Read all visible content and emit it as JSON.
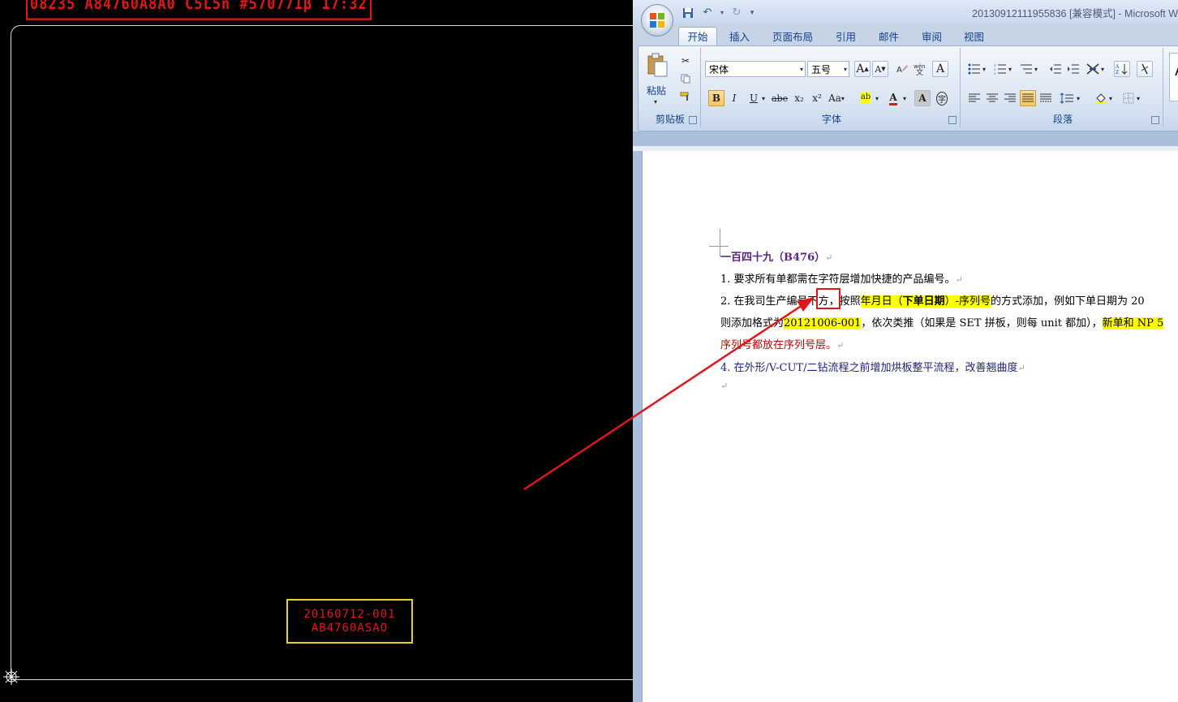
{
  "cad": {
    "top_banner": "08235  A84760A8A0  C5L5n  #570771β  17:32",
    "label_box": {
      "line1": "20160712-001",
      "line2": "AB4760ASAO"
    },
    "colors": {
      "label_text": "#e0161b",
      "label_box_border": "#e8d21e",
      "outline": "#d8d8d8"
    }
  },
  "word": {
    "window_title": "20130912111955836 [兼容模式] - Microsoft W",
    "tabs": [
      "开始",
      "插入",
      "页面布局",
      "引用",
      "邮件",
      "审阅",
      "视图"
    ],
    "active_tab": "开始",
    "ribbon": {
      "clipboard": {
        "paste_label": "粘贴",
        "group_label": "剪贴板"
      },
      "font": {
        "font_name": "宋体",
        "font_size": "五号",
        "grow": "A",
        "shrink": "A",
        "bold": "B",
        "italic": "I",
        "underline": "U",
        "strike": "abe",
        "subscript": "x₂",
        "superscript": "x²",
        "change_case": "Aa",
        "highlight": "ab",
        "font_color": "A",
        "char_shade": "A",
        "enclose": "字",
        "group_label": "字体"
      },
      "paragraph": {
        "group_label": "段落"
      },
      "styles": {
        "preview": "A"
      }
    },
    "document": {
      "heading": "一百四十九（B476）",
      "line1": "1. 要求所有单都需在字符层增加快捷的产品编号。",
      "line2": {
        "pre": "2. 在我司生产编号",
        "boxed": "下方",
        "mid": "，按照",
        "hl_a": "年月日（",
        "hl_b": "下单日期",
        "hl_c": "）-序列号",
        "post": "的方式添加，例如下单日期为 20"
      },
      "line3": {
        "pre": "则添加格式为",
        "hl": "20121006-001",
        "mid": "，依次类推（如果是 SET 拼板，则每 unit 都加），",
        "hl2": "新单和 NP 5"
      },
      "line4": "序列号都放在序列号层。",
      "line5": "4. 在外形/V-CUT/二钻流程之前增加烘板整平流程，改善翘曲度",
      "para_mark": "↵"
    },
    "colors": {
      "accent": "#15428b",
      "highlight": "#ffff00",
      "callout": "#e0161b"
    }
  }
}
